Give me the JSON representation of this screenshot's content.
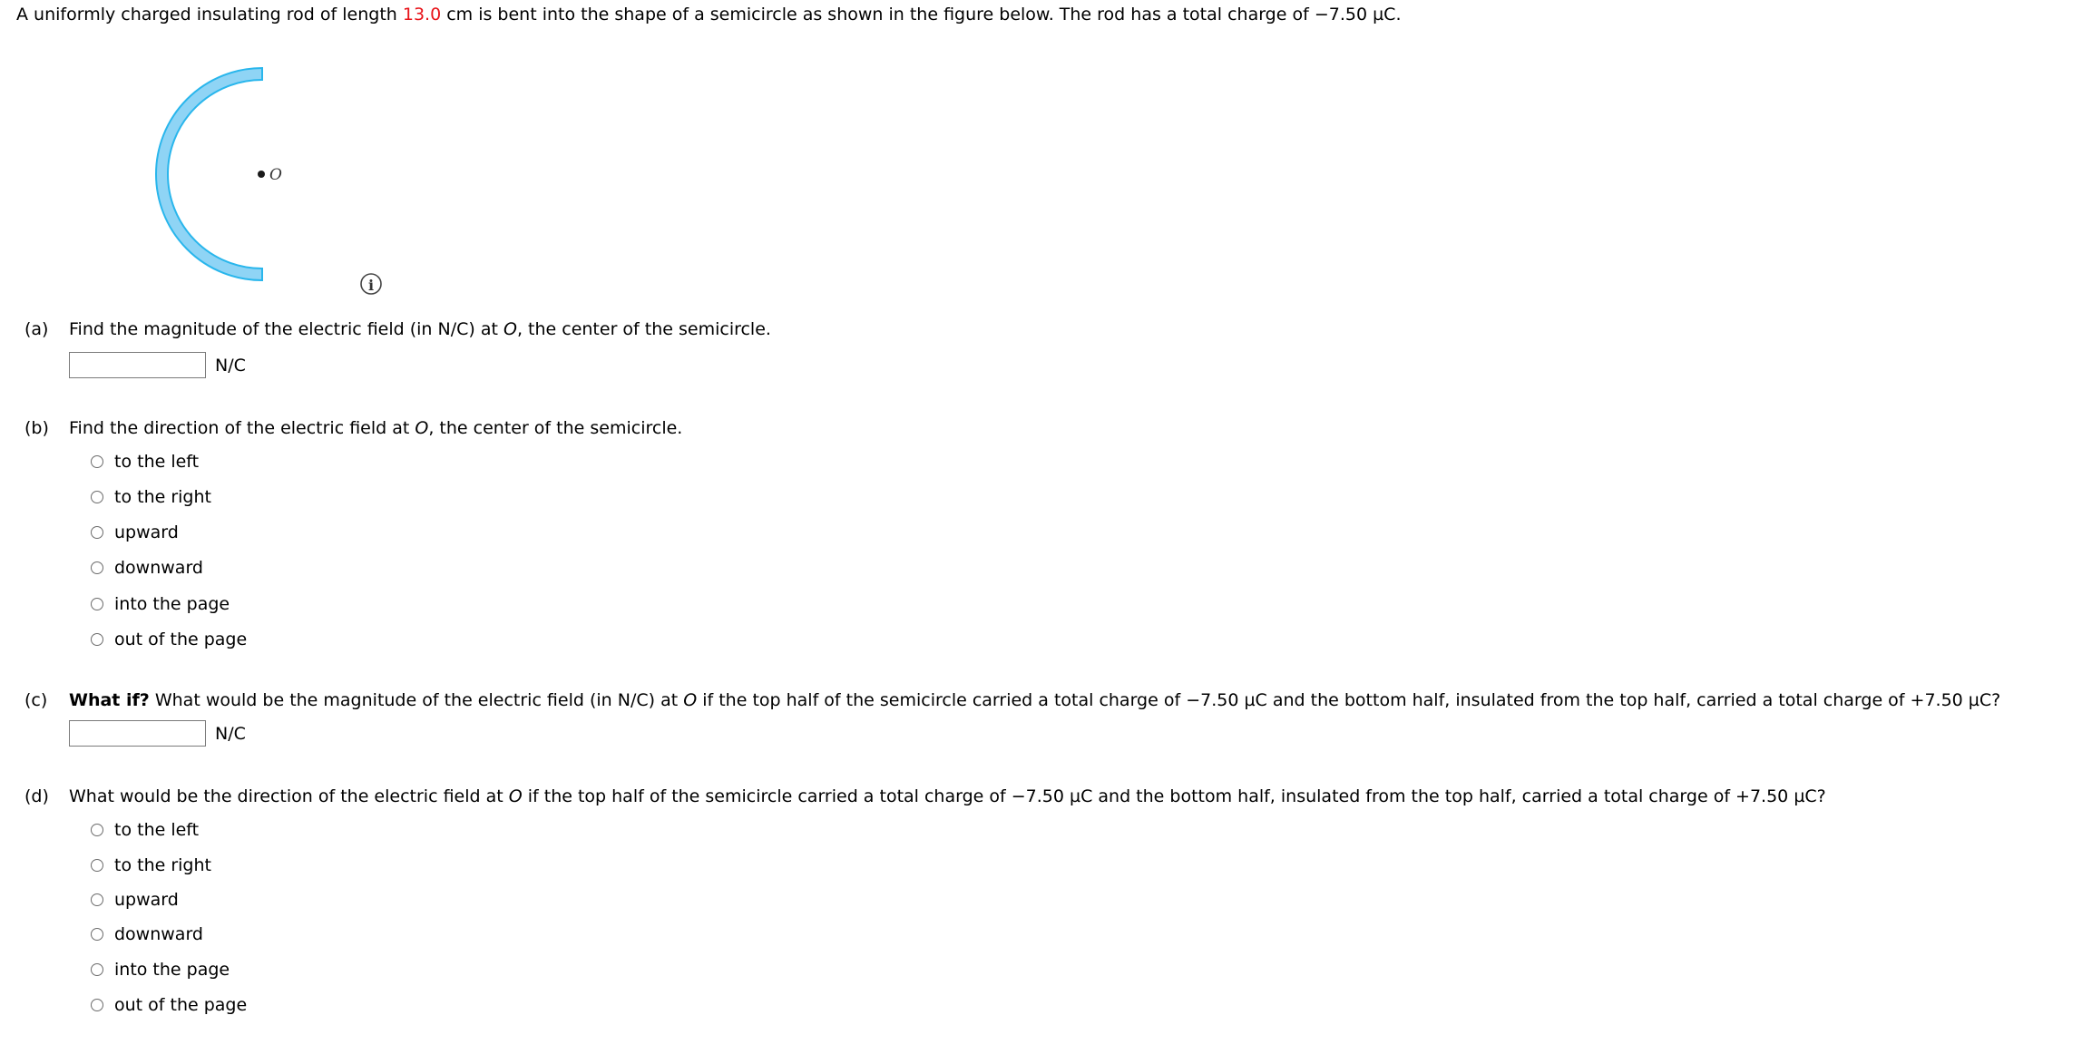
{
  "intro": {
    "text_before": "A uniformly charged insulating rod of length ",
    "length_value": "13.0",
    "text_after": " cm is bent into the shape of a semicircle as shown in the figure below. The rod has a total charge of −7.50 µC."
  },
  "figure": {
    "point_label": "O",
    "rod_fill_color": "#8fd4f5",
    "rod_edge_color": "#29b6ec",
    "info_icon": "info-icon"
  },
  "parts": {
    "a": {
      "label": "(a)",
      "text_before": "Find the magnitude of the electric field (in N/C) at ",
      "point": "O",
      "text_after": ", the center of the semicircle.",
      "input_value": "",
      "unit": "N/C"
    },
    "b": {
      "label": "(b)",
      "text_before": "Find the direction of the electric field at ",
      "point": "O",
      "text_after": ", the center of the semicircle.",
      "options": [
        "to the left",
        "to the right",
        "upward",
        "downward",
        "into the page",
        "out of the page"
      ]
    },
    "c": {
      "label": "(c)",
      "bold_prefix": "What if?",
      "text_before": " What would be the magnitude of the electric field (in N/C) at ",
      "point": "O",
      "text_after": " if the top half of the semicircle carried a total charge of −7.50 µC and the bottom half, insulated from the top half, carried a total charge of +7.50 µC?",
      "input_value": "",
      "unit": "N/C"
    },
    "d": {
      "label": "(d)",
      "text_before": "What would be the direction of the electric field at ",
      "point": "O",
      "text_after": " if the top half of the semicircle carried a total charge of −7.50 µC and the bottom half, insulated from the top half, carried a total charge of +7.50 µC?",
      "options": [
        "to the left",
        "to the right",
        "upward",
        "downward",
        "into the page",
        "out of the page"
      ]
    }
  }
}
